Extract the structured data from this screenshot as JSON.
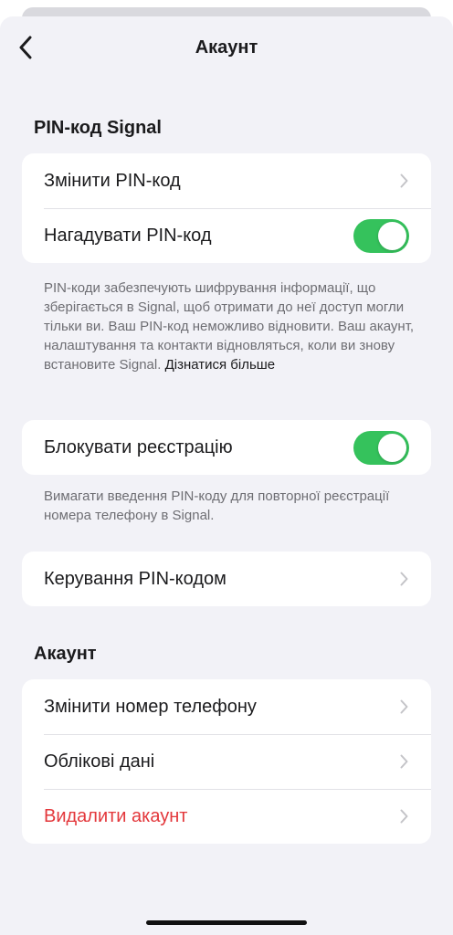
{
  "nav": {
    "title": "Акаунт"
  },
  "pin_section": {
    "header": "PIN-код Signal",
    "change_pin": "Змінити PIN-код",
    "remind_pin": "Нагадувати PIN-код",
    "remind_pin_enabled": true,
    "description": "PIN-коди забезпечують шифрування інформації, що зберігається в Signal, щоб отримати до неї доступ могли тільки ви. Ваш PIN-код неможливо відновити. Ваш акаунт, налаштування та контакти відновляться, коли ви знову встановите Signal.",
    "learn_more": "Дізнатися більше",
    "registration_lock": "Блокувати реєстрацію",
    "registration_lock_enabled": true,
    "registration_lock_description": "Вимагати введення PIN-коду для повторної реєстрації номера телефону в Signal.",
    "manage_pin": "Керування PIN-кодом"
  },
  "account_section": {
    "header": "Акаунт",
    "change_number": "Змінити номер телефону",
    "account_data": "Облікові дані",
    "delete_account": "Видалити акаунт"
  },
  "colors": {
    "toggle_on": "#35c25c",
    "danger": "#e3373b",
    "background": "#f2f2f7"
  }
}
